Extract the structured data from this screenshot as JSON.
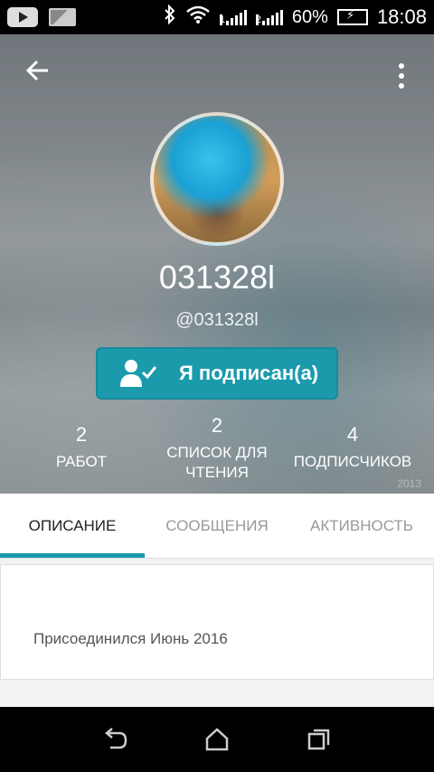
{
  "status_bar": {
    "battery_percent": "60%",
    "time": "18:08",
    "sim1_label": "1",
    "sim2_label": "2",
    "icons": [
      "youtube-icon",
      "image-icon",
      "bluetooth-icon",
      "wifi-icon",
      "signal-icon",
      "signal-icon",
      "battery-charging-icon"
    ]
  },
  "header": {
    "back_icon": "arrow-left-icon",
    "menu_icon": "more-vertical-icon",
    "display_name": "031328l",
    "handle": "@031328l",
    "follow_button": {
      "label": "Я подписан(а)",
      "icon": "person-check-icon"
    },
    "stats": [
      {
        "value": "2",
        "label": "РАБОТ"
      },
      {
        "value": "2",
        "label": "СПИСОК ДЛЯ ЧТЕНИЯ"
      },
      {
        "value": "4",
        "label": "ПОДПИСЧИКОВ"
      }
    ],
    "watermark": "2013"
  },
  "tabs": [
    {
      "label": "ОПИСАНИЕ",
      "active": true
    },
    {
      "label": "СООБЩЕНИЯ",
      "active": false
    },
    {
      "label": "АКТИВНОСТЬ",
      "active": false
    }
  ],
  "about": {
    "joined_text": "Присоединился Июнь 2016"
  },
  "nav_bar": {
    "icons": [
      "back-nav-icon",
      "home-icon",
      "recent-apps-icon"
    ]
  },
  "colors": {
    "accent": "#1b9aac",
    "status_bar": "#000000",
    "tab_active_text": "#222222",
    "tab_inactive_text": "#999999"
  }
}
